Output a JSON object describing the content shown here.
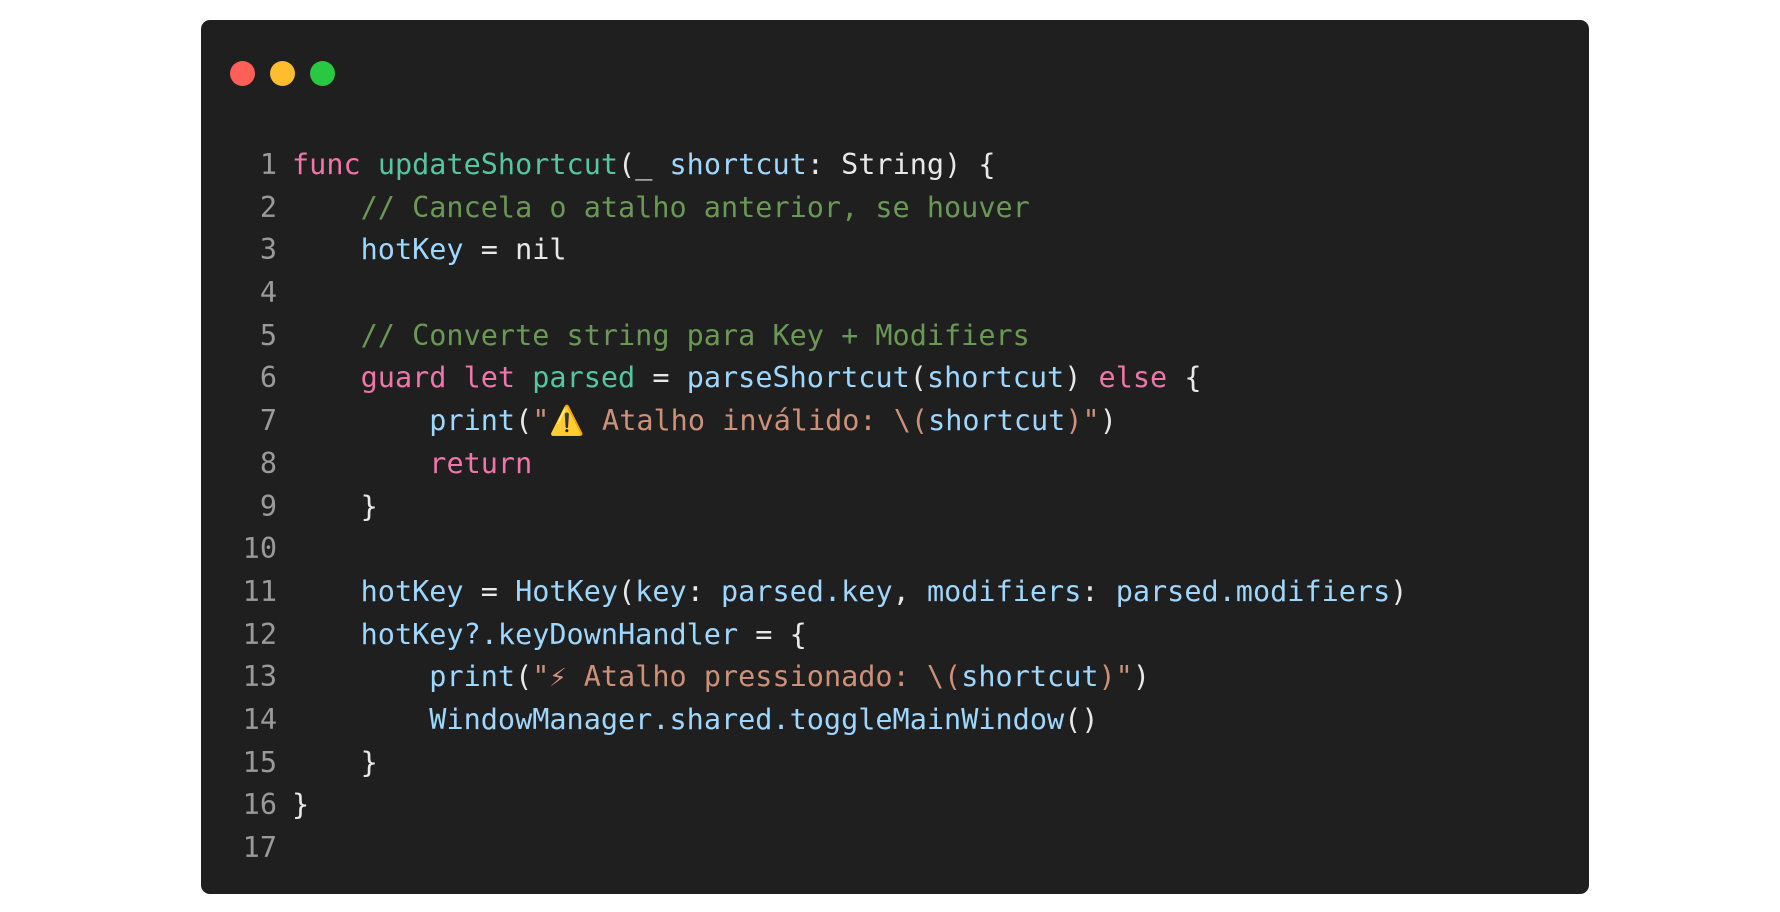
{
  "window": {
    "controls": [
      {
        "name": "close",
        "color": "#fe5f57"
      },
      {
        "name": "minimize",
        "color": "#febc2e"
      },
      {
        "name": "zoom",
        "color": "#28c840"
      }
    ]
  },
  "colors": {
    "keyword": "#f075ab",
    "function_name": "#54c7a0",
    "identifier": "#9ed7ff",
    "comment": "#6a9955",
    "string": "#ce9178",
    "plain": "#e8e8e8",
    "line_number": "#9a9a9a"
  },
  "code": {
    "language": "Swift",
    "lines": [
      {
        "number": "1",
        "tokens": [
          {
            "t": "func",
            "k": "keyword"
          },
          {
            "t": " ",
            "k": "plain"
          },
          {
            "t": "updateShortcut",
            "k": "function_name"
          },
          {
            "t": "(_ ",
            "k": "plain"
          },
          {
            "t": "shortcut",
            "k": "identifier"
          },
          {
            "t": ": String) {",
            "k": "plain"
          }
        ]
      },
      {
        "number": "2",
        "tokens": [
          {
            "t": "    ",
            "k": "plain"
          },
          {
            "t": "// Cancela o atalho anterior, se houver",
            "k": "comment"
          }
        ]
      },
      {
        "number": "3",
        "tokens": [
          {
            "t": "    ",
            "k": "plain"
          },
          {
            "t": "hotKey",
            "k": "identifier"
          },
          {
            "t": " = nil",
            "k": "plain"
          }
        ]
      },
      {
        "number": "4",
        "tokens": []
      },
      {
        "number": "5",
        "tokens": [
          {
            "t": "    ",
            "k": "plain"
          },
          {
            "t": "// Converte string para Key + Modifiers",
            "k": "comment"
          }
        ]
      },
      {
        "number": "6",
        "tokens": [
          {
            "t": "    ",
            "k": "plain"
          },
          {
            "t": "guard",
            "k": "keyword"
          },
          {
            "t": " ",
            "k": "plain"
          },
          {
            "t": "let",
            "k": "keyword"
          },
          {
            "t": " ",
            "k": "plain"
          },
          {
            "t": "parsed",
            "k": "function_name"
          },
          {
            "t": " = ",
            "k": "plain"
          },
          {
            "t": "parseShortcut",
            "k": "identifier"
          },
          {
            "t": "(",
            "k": "plain"
          },
          {
            "t": "shortcut",
            "k": "identifier"
          },
          {
            "t": ") ",
            "k": "plain"
          },
          {
            "t": "else",
            "k": "keyword"
          },
          {
            "t": " {",
            "k": "plain"
          }
        ]
      },
      {
        "number": "7",
        "tokens": [
          {
            "t": "        ",
            "k": "plain"
          },
          {
            "t": "print",
            "k": "identifier"
          },
          {
            "t": "(",
            "k": "plain"
          },
          {
            "t": "\"⚠️ Atalho inválido: \\(",
            "k": "string"
          },
          {
            "t": "shortcut",
            "k": "identifier"
          },
          {
            "t": ")\"",
            "k": "string"
          },
          {
            "t": ")",
            "k": "plain"
          }
        ]
      },
      {
        "number": "8",
        "tokens": [
          {
            "t": "        ",
            "k": "plain"
          },
          {
            "t": "return",
            "k": "keyword"
          }
        ]
      },
      {
        "number": "9",
        "tokens": [
          {
            "t": "    }",
            "k": "plain"
          }
        ]
      },
      {
        "number": "10",
        "tokens": []
      },
      {
        "number": "11",
        "tokens": [
          {
            "t": "    ",
            "k": "plain"
          },
          {
            "t": "hotKey",
            "k": "identifier"
          },
          {
            "t": " = ",
            "k": "plain"
          },
          {
            "t": "HotKey",
            "k": "identifier"
          },
          {
            "t": "(",
            "k": "plain"
          },
          {
            "t": "key",
            "k": "identifier"
          },
          {
            "t": ": ",
            "k": "plain"
          },
          {
            "t": "parsed.key",
            "k": "identifier"
          },
          {
            "t": ", ",
            "k": "plain"
          },
          {
            "t": "modifiers",
            "k": "identifier"
          },
          {
            "t": ": ",
            "k": "plain"
          },
          {
            "t": "parsed.modifiers",
            "k": "identifier"
          },
          {
            "t": ")",
            "k": "plain"
          }
        ]
      },
      {
        "number": "12",
        "tokens": [
          {
            "t": "    ",
            "k": "plain"
          },
          {
            "t": "hotKey?.keyDownHandler",
            "k": "identifier"
          },
          {
            "t": " = {",
            "k": "plain"
          }
        ]
      },
      {
        "number": "13",
        "tokens": [
          {
            "t": "        ",
            "k": "plain"
          },
          {
            "t": "print",
            "k": "identifier"
          },
          {
            "t": "(",
            "k": "plain"
          },
          {
            "t": "\"⚡ Atalho pressionado: \\(",
            "k": "string"
          },
          {
            "t": "shortcut",
            "k": "identifier"
          },
          {
            "t": ")\"",
            "k": "string"
          },
          {
            "t": ")",
            "k": "plain"
          }
        ]
      },
      {
        "number": "14",
        "tokens": [
          {
            "t": "        ",
            "k": "plain"
          },
          {
            "t": "WindowManager.shared.toggleMainWindow",
            "k": "identifier"
          },
          {
            "t": "()",
            "k": "plain"
          }
        ]
      },
      {
        "number": "15",
        "tokens": [
          {
            "t": "    }",
            "k": "plain"
          }
        ]
      },
      {
        "number": "16",
        "tokens": [
          {
            "t": "}",
            "k": "plain"
          }
        ]
      },
      {
        "number": "17",
        "tokens": []
      }
    ]
  }
}
